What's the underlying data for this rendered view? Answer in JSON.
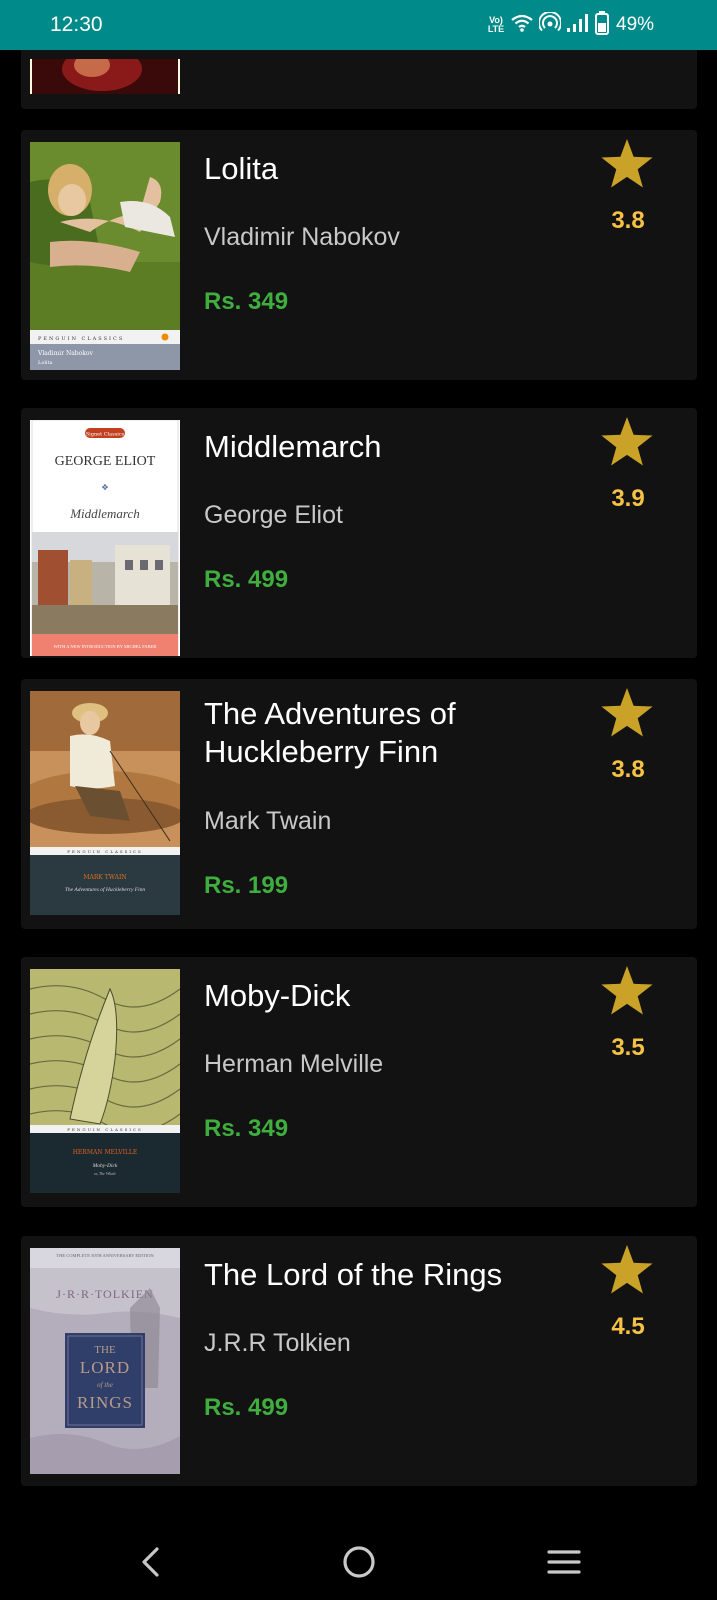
{
  "status_bar": {
    "time": "12:30",
    "network_label": "LTE",
    "volte_label": "Vo)",
    "battery": "49%",
    "icons": [
      "volte-lte-icon",
      "wifi-icon",
      "hotspot-icon",
      "signal-icon",
      "battery-icon"
    ]
  },
  "books": [
    {
      "title": "Lolita",
      "author": "Vladimir Nabokov",
      "price": "Rs. 349",
      "rating": "3.8"
    },
    {
      "title": "Middlemarch",
      "author": "George Eliot",
      "price": "Rs. 499",
      "rating": "3.9"
    },
    {
      "title": "The Adventures of Huckleberry Finn",
      "author": "Mark Twain",
      "price": "Rs. 199",
      "rating": "3.8"
    },
    {
      "title": "Moby-Dick",
      "author": "Herman Melville",
      "price": "Rs. 349",
      "rating": "3.5"
    },
    {
      "title": "The Lord of the Rings",
      "author": "J.R.R Tolkien",
      "price": "Rs. 499",
      "rating": "4.5"
    }
  ],
  "covers": {
    "lolita": {
      "series": "PENGUIN CLASSICS",
      "author": "Vladimir Nabokov",
      "title": "Lolita"
    },
    "middlemarch": {
      "series": "Signet Classics",
      "author": "GEORGE ELIOT",
      "title": "Middlemarch",
      "intro": "WITH A NEW INTRODUCTION BY MICHEL FABER"
    },
    "huck": {
      "series": "PENGUIN CLASSICS",
      "author": "MARK TWAIN",
      "title": "The Adventures of Huckleberry Finn"
    },
    "moby": {
      "series": "PENGUIN CLASSICS",
      "author": "HERMAN MELVILLE",
      "title": "Moby-Dick",
      "subtitle": "or, The Whale"
    },
    "lotr": {
      "banner": "THE COMPLETE 50TH ANNIVERSARY EDITION",
      "author": "J·R·R·TOLKIEN",
      "title_line1": "THE",
      "title_line2": "LORD",
      "title_line3": "of the",
      "title_line4": "RINGS"
    }
  },
  "nav": {
    "icons": [
      "back-icon",
      "home-icon",
      "menu-icon"
    ]
  },
  "colors": {
    "status_bar": "#008a89",
    "card": "#121212",
    "price": "#3fae3f",
    "rating": "#f6c244",
    "star": "#c9a227"
  }
}
